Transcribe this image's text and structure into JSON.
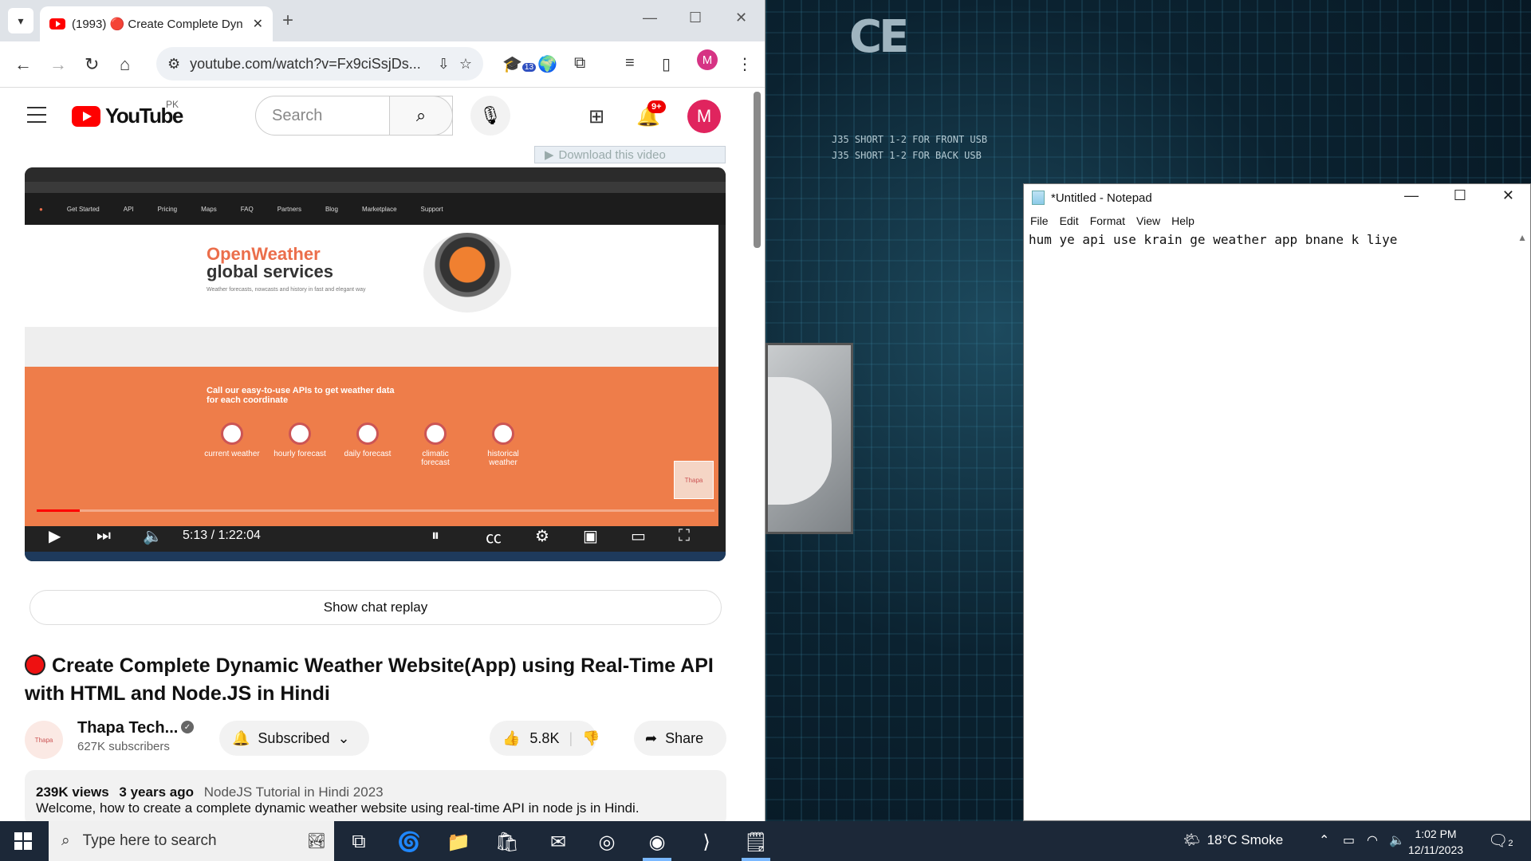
{
  "browser": {
    "tab_title": "(1993) 🔴 Create Complete Dyn",
    "url": "youtube.com/watch?v=Fx9ciSsjDs...",
    "extension_badge": "13",
    "profile_initial": "M"
  },
  "youtube": {
    "logo_text": "YouTube",
    "region": "PK",
    "search_placeholder": "Search",
    "notif_count": "9+",
    "avatar_initial": "M",
    "download_bar": "Download this video",
    "video": {
      "time": "5:13 / 1:22:04",
      "progress_fraction": 0.064,
      "ow_title": "OpenWeather",
      "ow_subtitle": "global services",
      "ow_desc": "Weather forecasts, nowcasts and history in fast and elegant way",
      "or_title": "Call our easy-to-use APIs to get weather data for each coordinate",
      "nav_items": [
        "Get Started",
        "API",
        "Pricing",
        "Maps",
        "FAQ",
        "Partners",
        "Blog",
        "Marketplace",
        "Support"
      ],
      "features": [
        "current weather",
        "hourly forecast",
        "daily forecast",
        "climatic forecast",
        "historical weather"
      ]
    },
    "chat_replay": "Show chat replay",
    "title": "Create Complete Dynamic Weather Website(App) using Real-Time API with HTML and Node.JS in Hindi",
    "channel": {
      "name": "Thapa Tech...",
      "subscribers": "627K subscribers",
      "subscribe_label": "Subscribed"
    },
    "likes": "5.8K",
    "share_label": "Share",
    "description": {
      "views": "239K views",
      "age": "3 years ago",
      "tag": "NodeJS Tutorial in Hindi 2023",
      "text": "Welcome, how to create a complete dynamic weather website using real-time API in node js in Hindi."
    }
  },
  "notepad": {
    "title": "*Untitled - Notepad",
    "menu": [
      "File",
      "Edit",
      "Format",
      "View",
      "Help"
    ],
    "content": "hum ye api use krain ge weather app bnane k liye"
  },
  "taskbar": {
    "search_placeholder": "Type here to search",
    "weather": "18°C  Smoke",
    "time": "1:02 PM",
    "date": "12/11/2023",
    "notif_count": "2"
  },
  "wallpaper_labels": [
    "J35 SHORT 1-2 FOR FRONT USB",
    "J35 SHORT 1-2 FOR BACK USB",
    "CE"
  ]
}
